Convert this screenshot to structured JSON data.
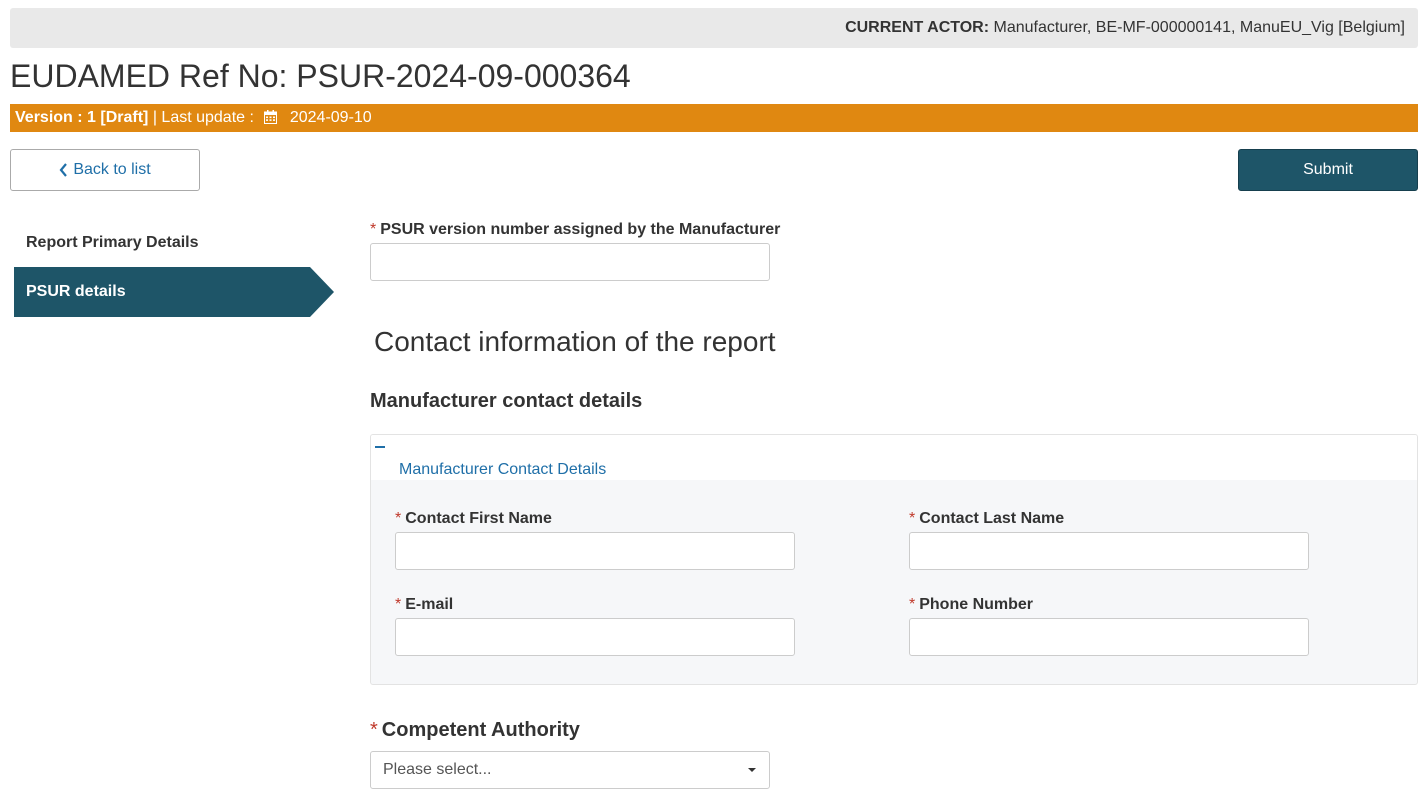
{
  "header": {
    "actor_label": "CURRENT ACTOR:",
    "actor_value": "Manufacturer, BE-MF-000000141, ManuEU_Vig [Belgium]",
    "ref_title": "EUDAMED Ref No: PSUR-2024-09-000364",
    "version_label": "Version : 1 [Draft]",
    "last_update_label": "| Last update :",
    "last_update_date": "2024-09-10"
  },
  "toolbar": {
    "back_label": "Back to list",
    "submit_label": "Submit"
  },
  "sidebar": {
    "items": [
      {
        "label": "Report Primary Details",
        "active": false
      },
      {
        "label": "PSUR details",
        "active": true
      }
    ]
  },
  "form": {
    "required_mark": "*",
    "psur_version_label": "PSUR version number assigned by the Manufacturer",
    "psur_version_value": "",
    "contact_section_title": "Contact information of the report",
    "manufacturer_contact_heading": "Manufacturer contact details",
    "panel": {
      "title": "Manufacturer Contact Details",
      "first_name_label": "Contact First Name",
      "last_name_label": "Contact Last Name",
      "email_label": "E-mail",
      "phone_label": "Phone Number",
      "first_name_value": "",
      "last_name_value": "",
      "email_value": "",
      "phone_value": ""
    },
    "competent_authority_label": "Competent Authority",
    "competent_authority_placeholder": "Please select..."
  },
  "colors": {
    "version_bar": "#e08811",
    "primary_dark": "#1e5568",
    "link": "#1f6fa8",
    "required": "#c0392b"
  },
  "icons": [
    "calendar-icon",
    "chevron-left-icon",
    "minus-icon",
    "caret-down-icon"
  ]
}
